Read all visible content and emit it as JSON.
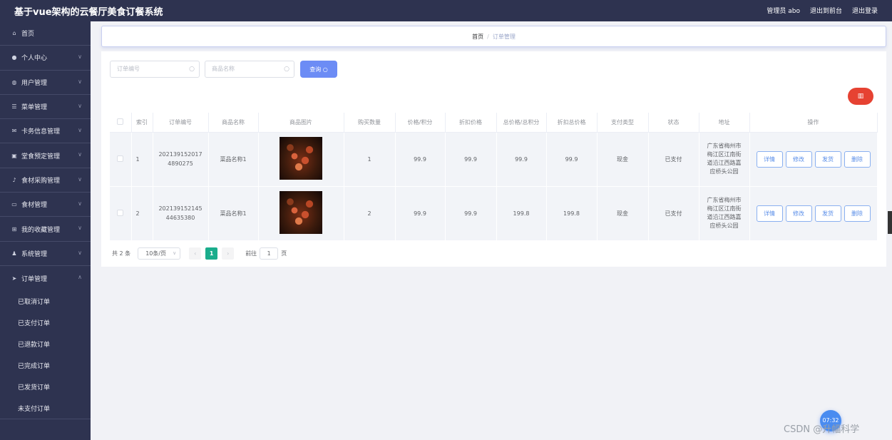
{
  "header": {
    "title": "基于vue架构的云餐厅美食订餐系统",
    "user_label": "管理员 abo",
    "front_label": "退出到前台",
    "logout_label": "退出登录"
  },
  "sidebar": {
    "items": [
      {
        "label": "首页",
        "icon": "home-icon",
        "glyph": "⌂"
      },
      {
        "label": "个人中心",
        "icon": "user-icon",
        "glyph": "●"
      },
      {
        "label": "用户管理",
        "icon": "globe-icon",
        "glyph": "◍"
      },
      {
        "label": "菜单管理",
        "icon": "list-icon",
        "glyph": "☰"
      },
      {
        "label": "卡务信息管理",
        "icon": "mail-icon",
        "glyph": "✉"
      },
      {
        "label": "堂食预定管理",
        "icon": "trash-icon",
        "glyph": "▣"
      },
      {
        "label": "食材采购管理",
        "icon": "mic-icon",
        "glyph": "♪"
      },
      {
        "label": "食材管理",
        "icon": "monitor-icon",
        "glyph": "▭"
      },
      {
        "label": "我的收藏管理",
        "icon": "grid-icon",
        "glyph": "⊞"
      },
      {
        "label": "系统管理",
        "icon": "user-group-icon",
        "glyph": "♟"
      }
    ],
    "open_menu": {
      "label": "订单管理",
      "icon": "send-icon",
      "glyph": "➤",
      "children": [
        "已取消订单",
        "已支付订单",
        "已退款订单",
        "已完成订单",
        "已发货订单",
        "未支付订单"
      ]
    }
  },
  "breadcrumb": {
    "home": "首页",
    "separator": "/",
    "current": "订单管理"
  },
  "search": {
    "order_no_placeholder": "订单编号",
    "product_name_placeholder": "商品名称",
    "query_label": "查询"
  },
  "table": {
    "headers": [
      "索引",
      "订单编号",
      "商品名称",
      "商品图片",
      "购买数量",
      "价格/积分",
      "折扣价格",
      "总价格/总积分",
      "折扣总价格",
      "支付类型",
      "状态",
      "地址",
      "操作"
    ],
    "rows": [
      {
        "index": "1",
        "order_no": "202139152017 4890275",
        "product_name": "菜品名称1",
        "quantity": "1",
        "price": "99.9",
        "discount_price": "99.9",
        "total_price": "99.9",
        "discount_total": "99.9",
        "pay_type": "现金",
        "status": "已支付",
        "address": "广东省梅州市梅江区江南街道沿江西路嘉应桥头公园"
      },
      {
        "index": "2",
        "order_no": "202139152145 44635380",
        "product_name": "菜品名称1",
        "quantity": "2",
        "price": "99.9",
        "discount_price": "99.9",
        "total_price": "199.8",
        "discount_total": "199.8",
        "pay_type": "现金",
        "status": "已支付",
        "address": "广东省梅州市梅江区江南街道沿江西路嘉应桥头公园"
      }
    ],
    "actions": {
      "detail": "详情",
      "edit": "修改",
      "ship": "发货",
      "delete": "删除"
    }
  },
  "pagination": {
    "total": "共 2 条",
    "page_size": "10条/页",
    "current_page": "1",
    "goto_label": "前往",
    "goto_value": "1",
    "page_suffix": "页"
  },
  "overlay": {
    "badge_text": "07:32",
    "watermark": "CSDN @升幅科学"
  },
  "colors": {
    "header_bg": "#2e3350",
    "primary": "#6c8cf5",
    "danger": "#e64232",
    "pager_active": "#1aad8c"
  }
}
